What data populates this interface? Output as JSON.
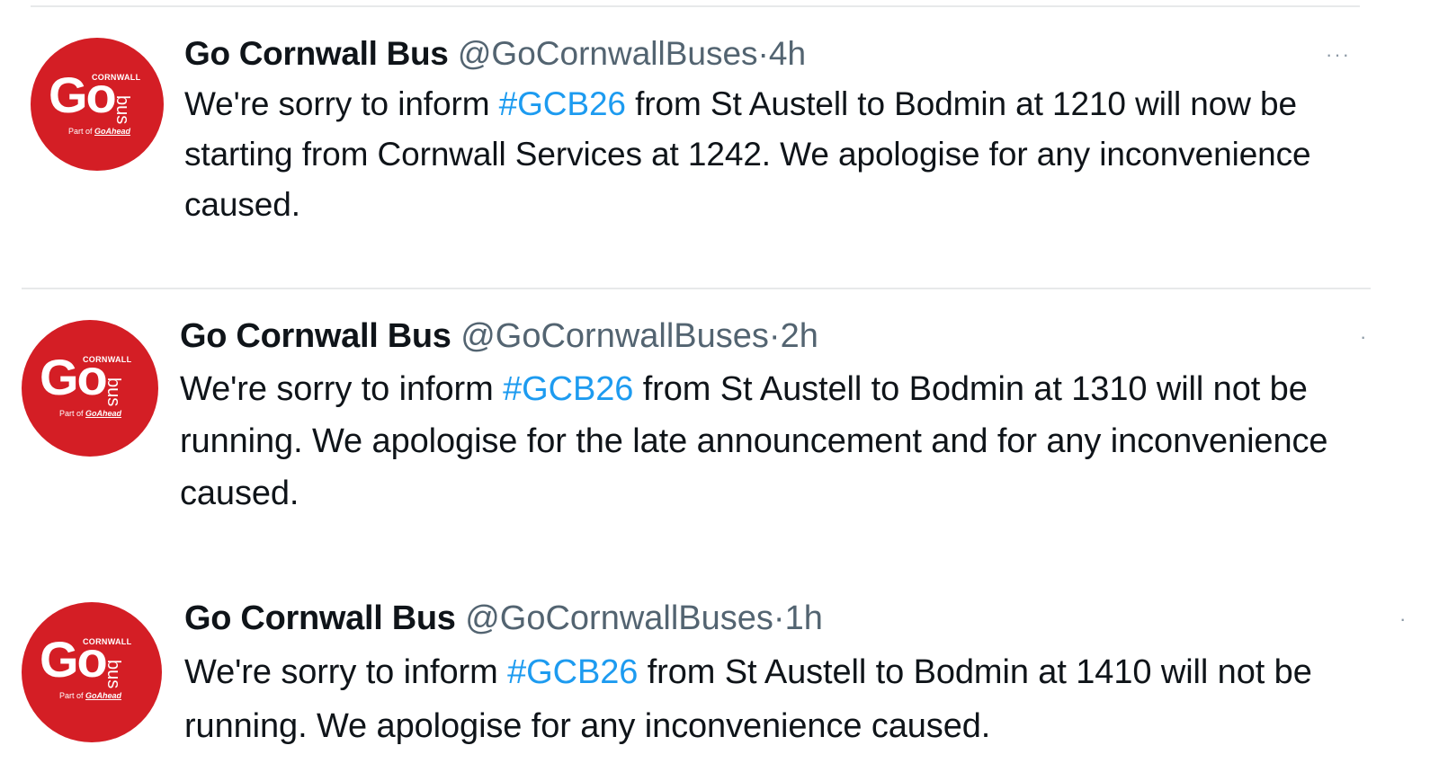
{
  "tweets": [
    {
      "display_name": "Go Cornwall Bus",
      "handle": "@GoCornwallBuses",
      "separator": "·",
      "time": "4h",
      "text_before": "We're sorry to inform ",
      "hashtag": "#GCB26",
      "text_after": " from St Austell to Bodmin at 1210 will now be starting from Cornwall Services at 1242. We apologise for any inconvenience caused.",
      "more_icon": "···",
      "avatar": {
        "go": "Go",
        "cornwall": "CORNWALL",
        "bus": "bus",
        "part_of": "Part of ",
        "goahead": "GoAhead"
      }
    },
    {
      "display_name": "Go Cornwall Bus",
      "handle": "@GoCornwallBuses",
      "separator": "·",
      "time": "2h",
      "text_before": "We're sorry to inform ",
      "hashtag": "#GCB26",
      "text_after": " from St Austell to Bodmin at 1310 will not be running. We apologise for the late announcement and for any inconvenience caused.",
      "more_icon": "·",
      "avatar": {
        "go": "Go",
        "cornwall": "CORNWALL",
        "bus": "bus",
        "part_of": "Part of ",
        "goahead": "GoAhead"
      }
    },
    {
      "display_name": "Go Cornwall Bus",
      "handle": "@GoCornwallBuses",
      "separator": "·",
      "time": "1h",
      "text_before": "We're sorry to inform ",
      "hashtag": "#GCB26",
      "text_after": " from St Austell to Bodmin at 1410 will not be running. We apologise for any inconvenience caused.",
      "more_icon": "·",
      "avatar": {
        "go": "Go",
        "cornwall": "CORNWALL",
        "bus": "bus",
        "part_of": "Part of ",
        "goahead": "GoAhead"
      }
    }
  ],
  "colors": {
    "brand_red": "#d41e25",
    "hashtag_blue": "#1d9bf0",
    "secondary_text": "#536471",
    "primary_text": "#0f1419",
    "divider": "#e7e9ea"
  }
}
